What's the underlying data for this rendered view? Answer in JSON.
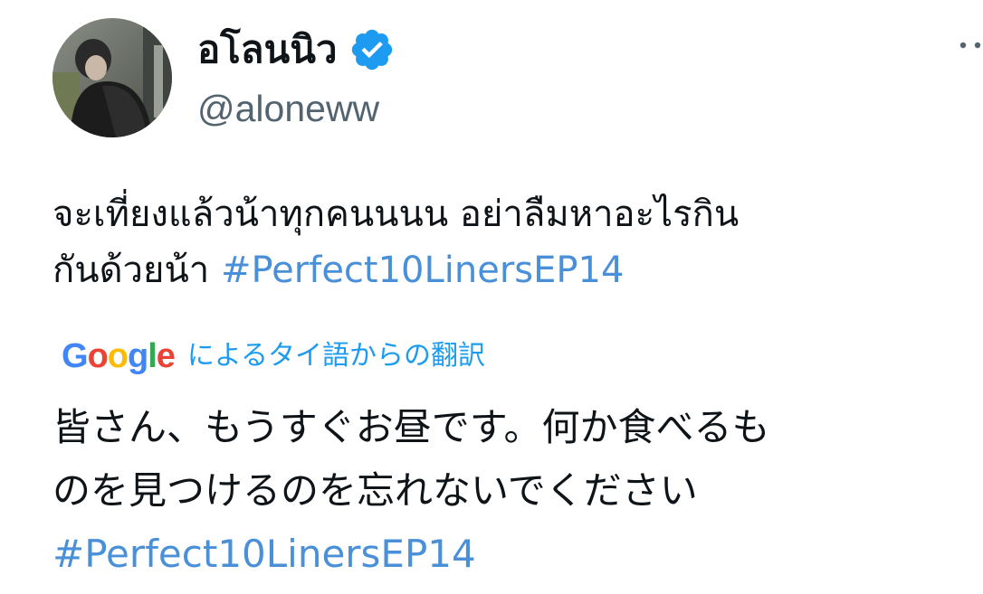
{
  "tweet": {
    "author": {
      "display_name": "อโลนนิว",
      "handle": "@aloneww",
      "verified": true,
      "avatar_icon": "user-photo-avatar"
    },
    "more_icon": "more-options-icon",
    "text_lines": [
      "จะเที่ยงแล้วน้าทุกคนนนน อย่าลืมหาอะไรกิน",
      "กันด้วยน้า "
    ],
    "hashtag": "#Perfect10LinersEP14",
    "translation": {
      "provider_logo_letters": [
        "G",
        "o",
        "o",
        "g",
        "l",
        "e"
      ],
      "provider_logo_colors": [
        "#4285F4",
        "#EA4335",
        "#FBBC05",
        "#4285F4",
        "#34A853",
        "#EA4335"
      ],
      "label": "によるタイ語からの翻訳",
      "lines": [
        "皆さん、もうすぐお昼です。何か食べるも",
        "のを見つけるのを忘れないでください"
      ],
      "hashtag": "#Perfect10LinersEP14"
    },
    "colors": {
      "link": "#4a90d9",
      "verified": "#1d9bf0",
      "text": "#0f1419",
      "secondary": "#536471"
    }
  }
}
